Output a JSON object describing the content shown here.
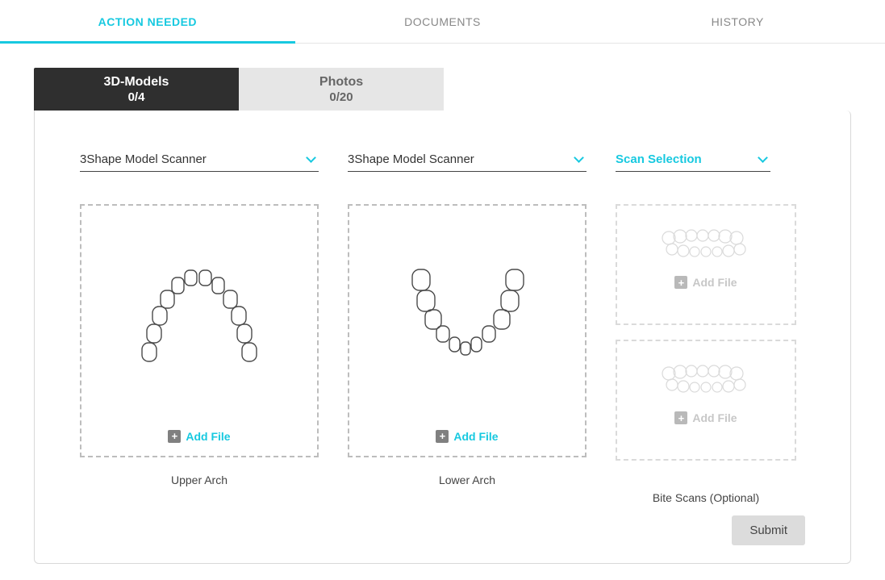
{
  "top_tabs": {
    "action_needed": "ACTION NEEDED",
    "documents": "DOCUMENTS",
    "history": "HISTORY"
  },
  "sub_tabs": {
    "models": {
      "label": "3D-Models",
      "count": "0/4"
    },
    "photos": {
      "label": "Photos",
      "count": "0/20"
    }
  },
  "selects": {
    "scanner1": "3Shape Model Scanner",
    "scanner2": "3Shape Model Scanner",
    "scan_selection": "Scan Selection"
  },
  "zones": {
    "upper": {
      "add": "Add File",
      "caption": "Upper Arch"
    },
    "lower": {
      "add": "Add File",
      "caption": "Lower Arch"
    },
    "bite": {
      "add": "Add File",
      "caption": "Bite Scans (Optional)"
    }
  },
  "submit": "Submit"
}
